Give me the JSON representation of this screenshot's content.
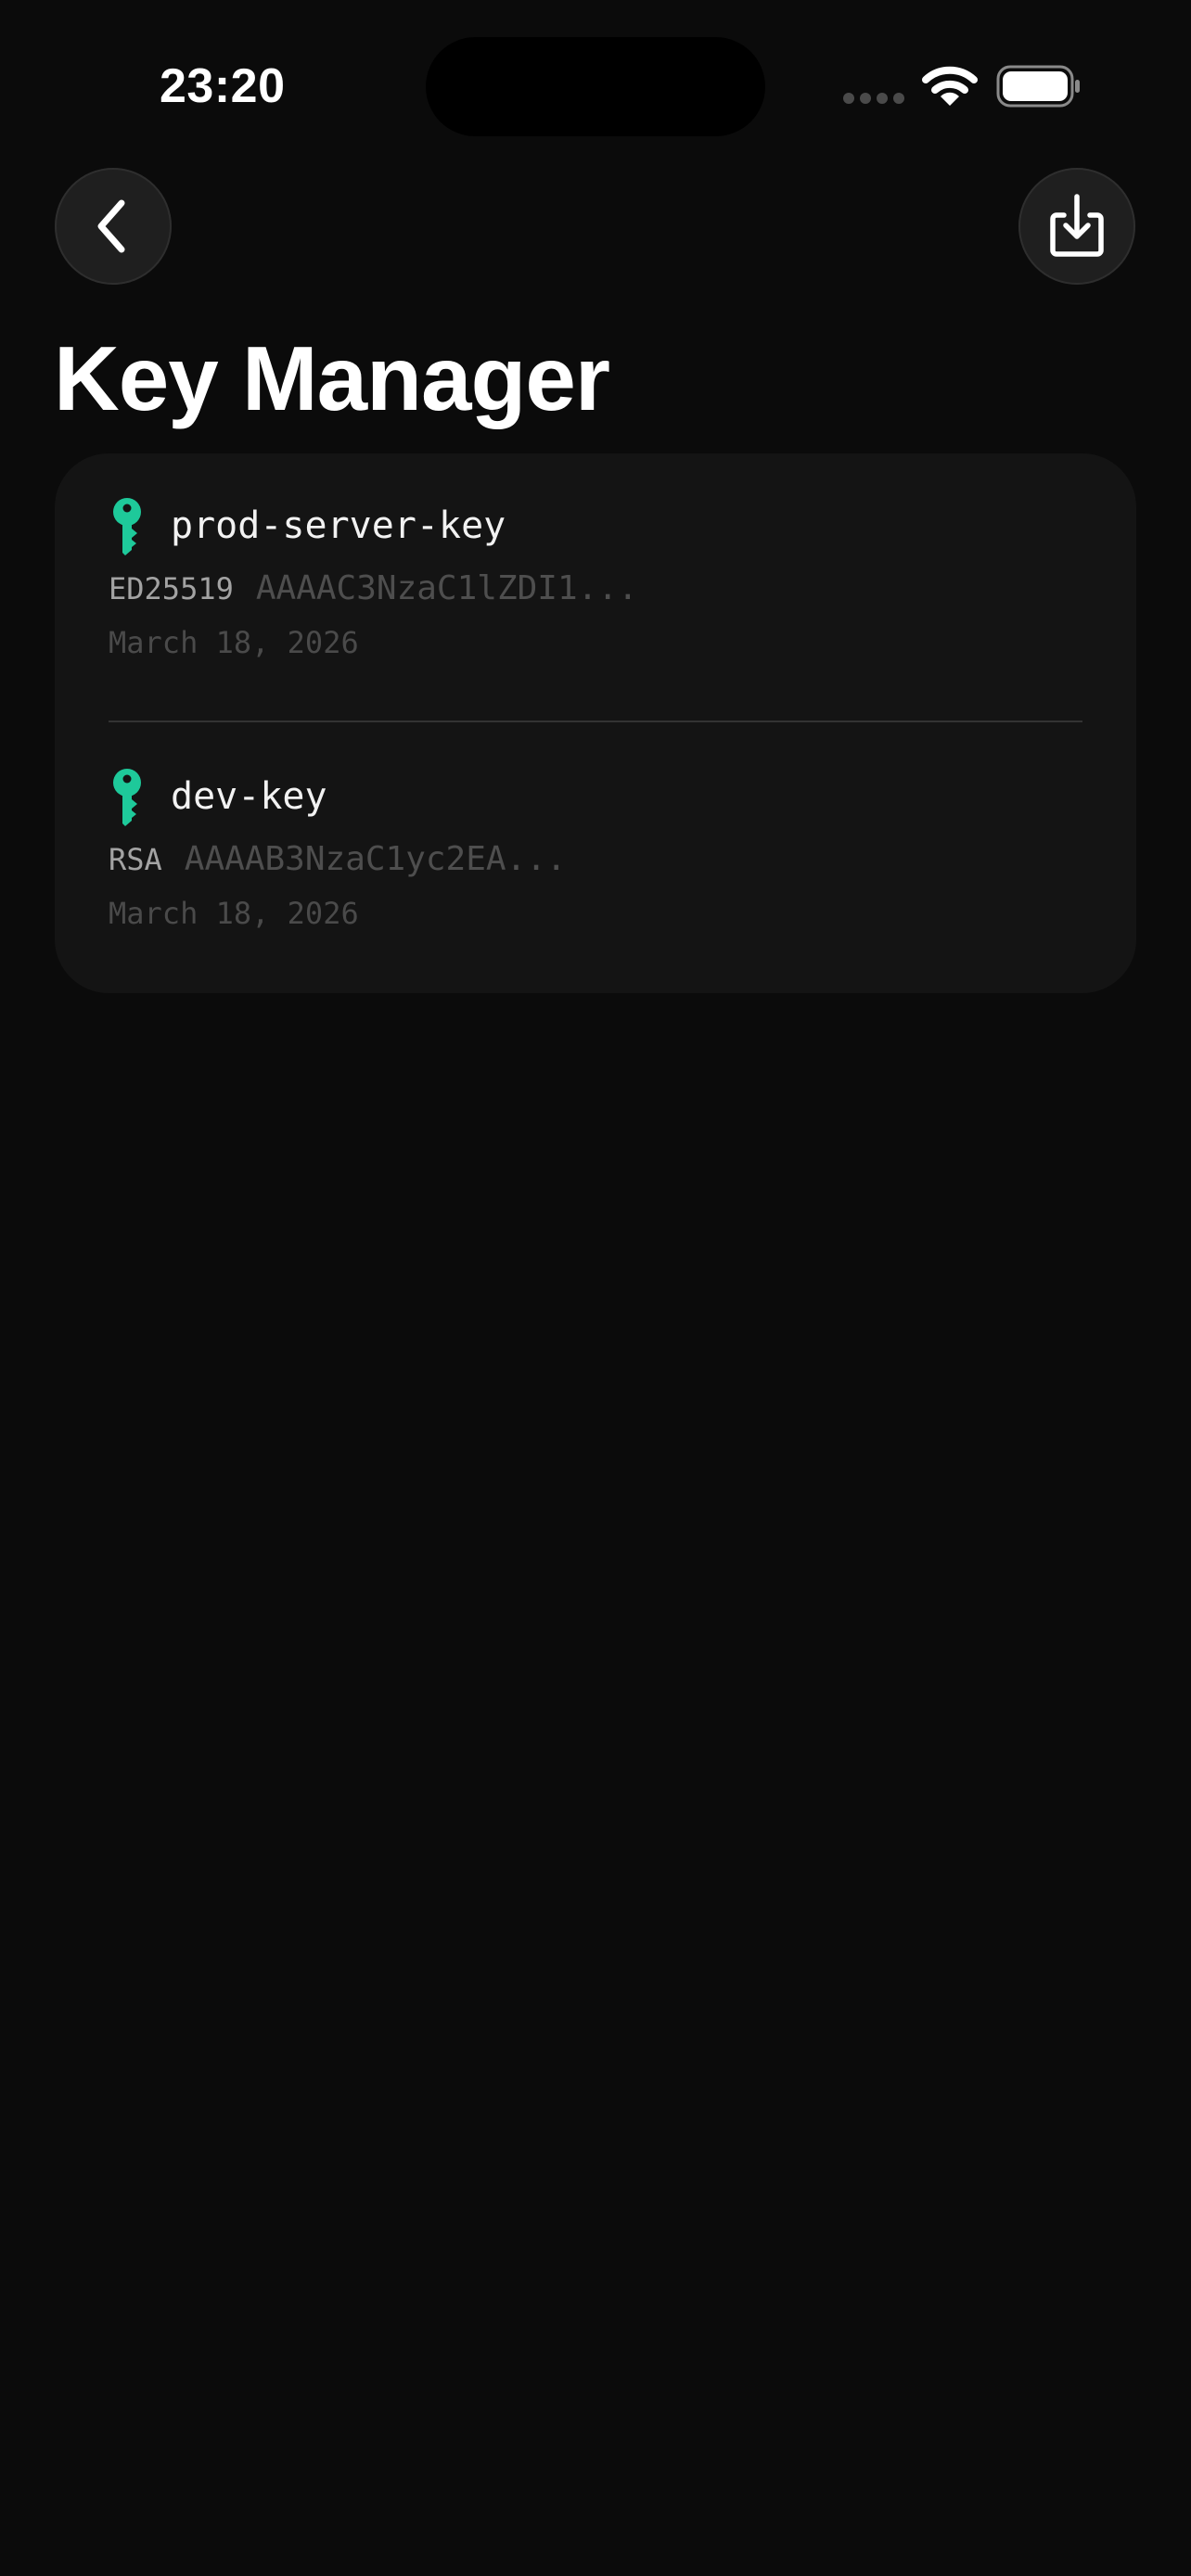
{
  "status_bar": {
    "time": "23:20"
  },
  "colors": {
    "background": "#0b0b0b",
    "card": "#141414",
    "accent_key": "#1ec99a"
  },
  "header": {
    "back_icon": "chevron-left-icon",
    "import_icon": "download-tray-icon",
    "title": "Key Manager"
  },
  "keys": [
    {
      "name": "prod-server-key",
      "type": "ED25519",
      "fingerprint": "AAAAC3NzaC1lZDI1...",
      "date": "March 18, 2026",
      "icon": "key-icon"
    },
    {
      "name": "dev-key",
      "type": "RSA",
      "fingerprint": "AAAAB3NzaC1yc2EA...",
      "date": "March 18, 2026",
      "icon": "key-icon"
    }
  ]
}
